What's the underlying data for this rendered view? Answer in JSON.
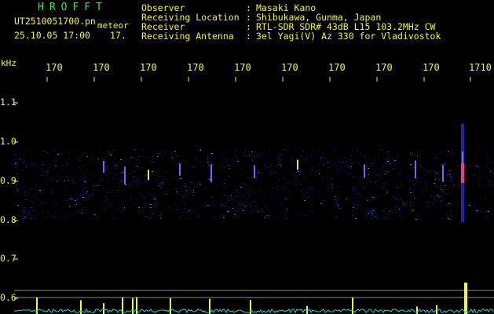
{
  "header": {
    "logo": "HROFFT",
    "file_name": "UT2510051700.pn",
    "type_label": "meteor",
    "datetime": "25.10.05 17:00",
    "minute": "17."
  },
  "info": [
    {
      "label": "Observer",
      "value": "Masaki Kano"
    },
    {
      "label": "Receiving Location",
      "value": "Shibukawa, Gunma, Japan"
    },
    {
      "label": "Receiver",
      "value": "RTL-SDR SDR# 43dB L15 103.2MHz CW"
    },
    {
      "label": "Receiving Antenna",
      "value": "3el Yagi(V) Az 330 for Vladivostok"
    }
  ],
  "info_colon": ":",
  "axis": {
    "unit": "kHz",
    "time_ticks": [
      "170",
      "170",
      "170",
      "170",
      "170",
      "170",
      "170",
      "170",
      "170",
      "1710"
    ],
    "freq_labels": [
      "1.1",
      "1.0",
      "0.9",
      "0.8",
      "0.7",
      "0.6"
    ]
  },
  "colors": {
    "background": "#000000",
    "label_yellow": "#f6f63a",
    "logo_green": "#2ee85a",
    "signal_band": "#2a2ad8",
    "signal_peak": "#e83a9a",
    "baseline": "#2ad0d0"
  }
}
